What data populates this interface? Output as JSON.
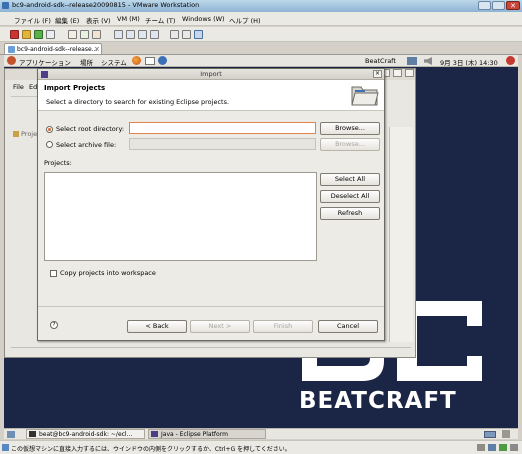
{
  "vmware": {
    "title": "bc9-android-sdk--release20090815 - VMware Workstation",
    "menu": [
      "ファイル (F)",
      "編集 (E)",
      "表示 (V)",
      "VM (M)",
      "チーム (T)",
      "Windows (W)",
      "ヘルプ (H)"
    ],
    "tab_label": "bc9-android-sdk--release...",
    "status_text": "この仮想マシンに直接入力するには、ウインドウの内側をクリックするか、Ctrl+G を押してください。"
  },
  "guest": {
    "panel_menu": [
      "アプリケーション",
      "場所",
      "システム"
    ],
    "user": "BeatCraft",
    "clock": "9月 3日 (木) 14:30",
    "taskbar": [
      {
        "label": "beat@bc9-android-sdk: ~/ecl..."
      },
      {
        "label": "Java - Eclipse Platform"
      }
    ],
    "wallpaper_text": "BEATCRAFT",
    "colors": {
      "desktop": "#1b2646",
      "panel": "#e8e6e1"
    }
  },
  "eclipse": {
    "menu_partial": [
      "File",
      "Ed"
    ],
    "project_explorer_label": "Proje"
  },
  "dialog": {
    "title": "Import",
    "header_title": "Import Projects",
    "header_desc": "Select a directory to search for existing Eclipse projects.",
    "root_dir_label": "Select root directory:",
    "root_dir_value": "",
    "archive_label": "Select archive file:",
    "archive_value": "",
    "browse_label": "Browse...",
    "projects_label": "Projects:",
    "select_all": "Select All",
    "deselect_all": "Deselect All",
    "refresh": "Refresh",
    "copy_checkbox_label": "Copy projects into workspace",
    "back": "< Back",
    "next": "Next >",
    "finish": "Finish",
    "cancel": "Cancel",
    "selected_option": "root_directory"
  }
}
